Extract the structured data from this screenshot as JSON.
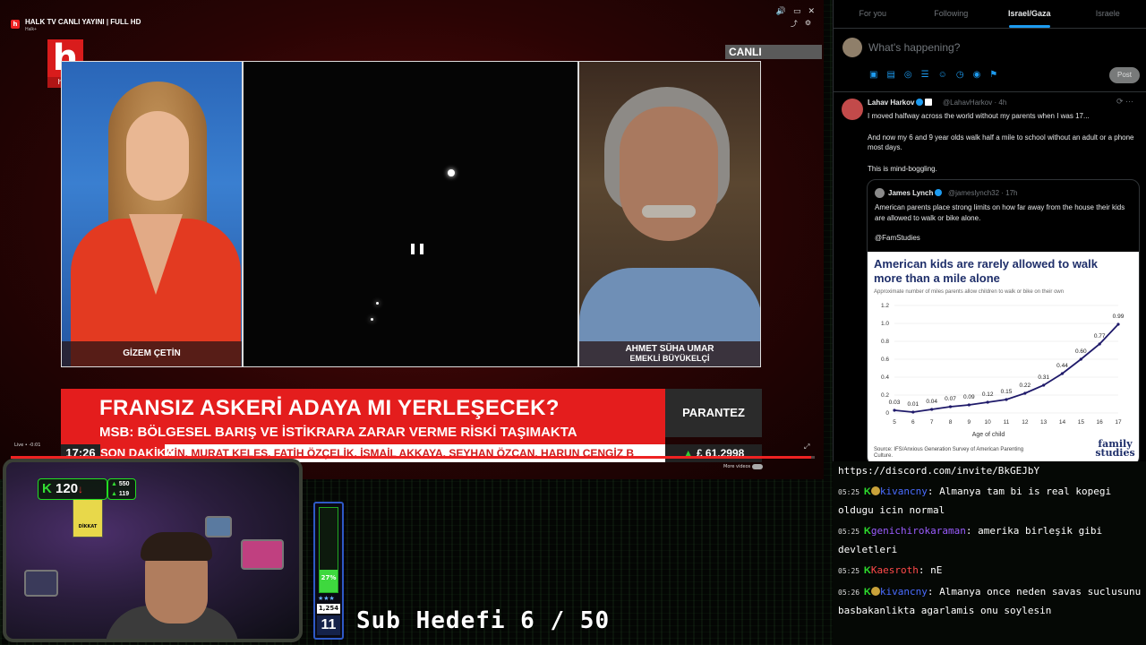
{
  "player": {
    "title": "HALK TV CANLI YAYINI | FULL HD",
    "channel": "Halk+",
    "logo_letter": "h",
    "logo_text": "halk",
    "live_badge": "CANLI",
    "presenter_name": "GİZEM ÇETİN",
    "guest_name": "AHMET SÜHA UMAR",
    "guest_title": "EMEKLİ BÜYÜKELÇİ",
    "headline": "FRANSIZ ASKERİ ADAYA MI YERLEŞECEK?",
    "subheadline": "MSB: BÖLGESEL BARIŞ VE İSTİKRARA ZARAR VERME RİSKİ TAŞIMAKTA",
    "program": "PARANTEZ",
    "ticker_time": "17:26",
    "ticker_label": "SON DAKİKA",
    "ticker_text": "KİN, MURAT KELEŞ, FATİH ÖZÇELİK, İSMAİL AKKAYA, SEYHAN ÖZCAN, HARUN CENGİZ B",
    "currency": "£ 61.2998",
    "live_time": "Live • -0:01",
    "more_videos": "More videos",
    "progress": 0.995,
    "icons": [
      "volume-icon",
      "cc-icon",
      "x-logo-icon",
      "share-icon",
      "settings-icon"
    ]
  },
  "webcam": {
    "follower_count": "120",
    "stat_a": "550",
    "stat_b": "119",
    "sign_text": "DİKKAT"
  },
  "meter": {
    "percent_label": "27%",
    "level": 0.27,
    "stars": "★★★",
    "count": "1,254",
    "number": "11"
  },
  "sub_goal": "Sub Hedefi 6 / 50",
  "twitter": {
    "tabs": [
      {
        "label": "For you",
        "active": false
      },
      {
        "label": "Following",
        "active": false
      },
      {
        "label": "Israel/Gaza",
        "active": true
      },
      {
        "label": "Israele",
        "active": false
      }
    ],
    "compose_placeholder": "What's happening?",
    "post_label": "Post",
    "tweet": {
      "name": "Lahav Harkov",
      "handle": "@LahavHarkov · 4h",
      "body": [
        "I moved halfway across the world without my parents when I was 17...",
        "And now my 6 and 9 year olds walk half a mile to school without an adult or a phone most days.",
        "This is mind-boggling."
      ]
    },
    "quote": {
      "name": "James Lynch",
      "handle": "@jameslynch32 · 17h",
      "body": [
        "American parents place strong limits on how far away from the house their kids are allowed to walk or bike alone.",
        "@FamStudies"
      ]
    }
  },
  "chart_data": {
    "type": "line",
    "title": "American kids are rarely allowed to walk more than a mile alone",
    "subtitle": "Approximate number of miles parents allow children to walk or bike on their own",
    "xlabel": "Age of child",
    "ylabel": "",
    "x": [
      5,
      6,
      7,
      8,
      9,
      10,
      11,
      12,
      13,
      14,
      15,
      16,
      17
    ],
    "values": [
      0.03,
      0.01,
      0.04,
      0.07,
      0.09,
      0.12,
      0.15,
      0.22,
      0.31,
      0.44,
      0.6,
      0.77,
      0.99
    ],
    "labels": [
      "0.03",
      "0.01",
      "0.04",
      "0.07",
      "0.09",
      "0.12",
      "0.15",
      "0.22",
      "0.31",
      "0.44",
      "0.60",
      "0.77",
      "0.99"
    ],
    "yticks": [
      "0",
      "0.2",
      "0.4",
      "0.6",
      "0.8",
      "1.0",
      "1.2"
    ],
    "ylim": [
      0,
      1.2
    ],
    "grid": true,
    "line_color": "#1f1a6a",
    "source": "Source: IFS/Anxious Generation Survey of American Parenting Culture.",
    "brand": "family studies"
  },
  "chat": {
    "invite": "https://discord.com/invite/BkGEJbY",
    "messages": [
      {
        "time": "05:25",
        "badge": true,
        "user": "kivancny",
        "color": "#4a6cff",
        "text": "Almanya tam bi is real kopegi oldugu icin normal"
      },
      {
        "time": "05:25",
        "badge": false,
        "user": "genichirokaraman",
        "color": "#9b5cff",
        "text": "amerika birleşik gibi devletleri"
      },
      {
        "time": "05:25",
        "badge": false,
        "user": "Kaesroth",
        "color": "#ff4a4a",
        "text": "nE"
      },
      {
        "time": "05:26",
        "badge": true,
        "user": "kivancny",
        "color": "#4a6cff",
        "text": "Almanya once neden savas suclusunu basbakanlikta agarlamis onu soylesin"
      }
    ]
  }
}
